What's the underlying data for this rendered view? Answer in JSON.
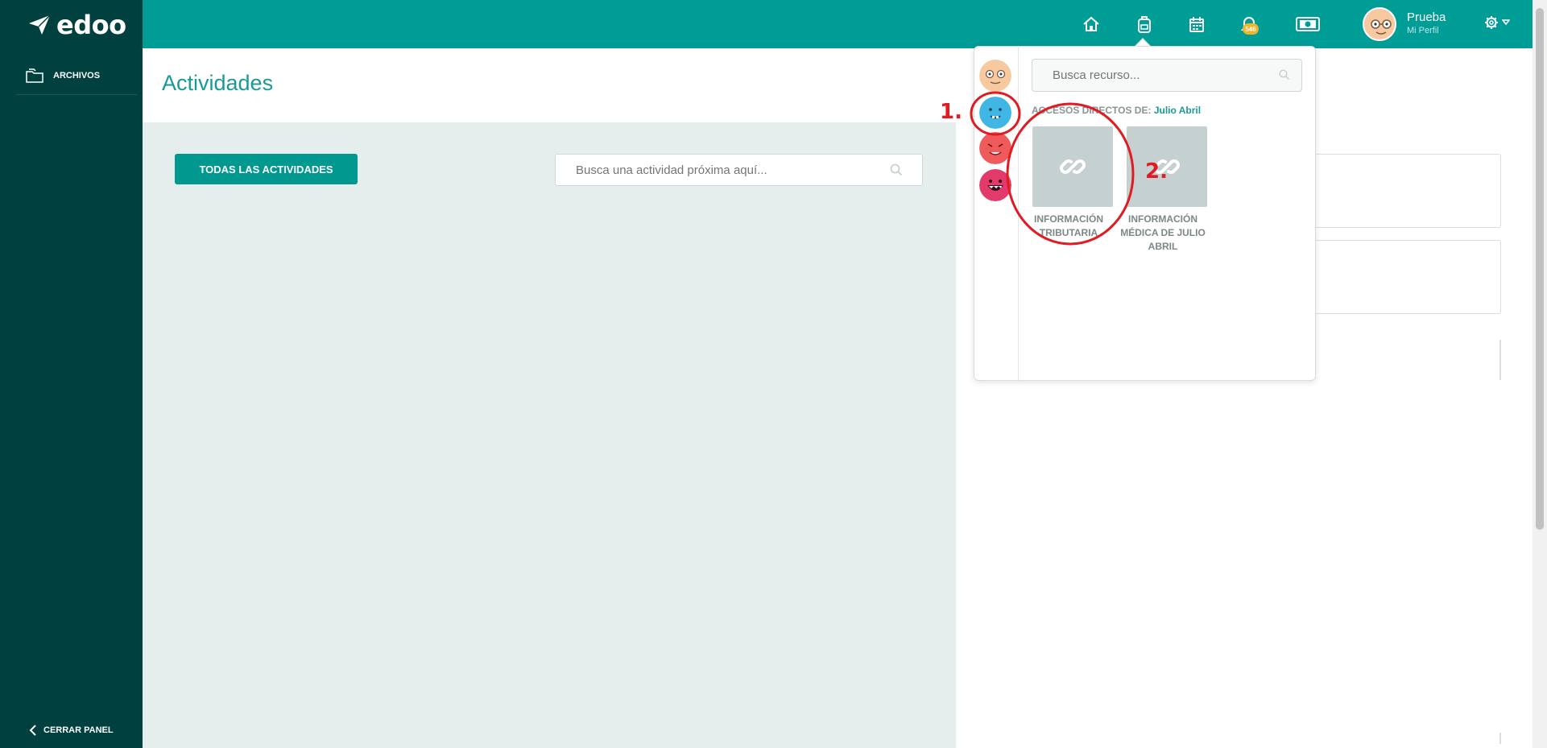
{
  "app": {
    "logo_text": "edoo"
  },
  "sidebar": {
    "items": [
      {
        "label": "ARCHIVOS",
        "icon": "folder-icon"
      }
    ],
    "close_label": "CERRAR PANEL"
  },
  "topbar": {
    "icons": [
      "home-icon",
      "backpack-icon",
      "calendar-icon",
      "bell-icon",
      "money-icon"
    ],
    "notification_count": "546",
    "user": {
      "name": "Prueba",
      "subtitle": "Mi Perfil"
    }
  },
  "main": {
    "title": "Actividades",
    "all_button": "TODAS LAS ACTIVIDADES",
    "search_placeholder": "Busca una actividad próxima aquí..."
  },
  "dropdown": {
    "search_placeholder": "Busca recurso...",
    "shortcuts_label": "ACCESOS DIRECTOS DE:",
    "shortcuts_owner": "Julio Abril",
    "tiles": [
      {
        "label": "INFORMACIÓN TRIBUTARIA",
        "icon": "link-icon"
      },
      {
        "label": "INFORMACIÓN MÉDICA DE JULIO ABRIL",
        "icon": "link-icon"
      }
    ]
  },
  "annotations": {
    "first": "1.",
    "second": "2."
  },
  "colors": {
    "sidebar": "#00413f",
    "topbar": "#009c96",
    "accent": "#1a9a94",
    "annotation": "#e01b22"
  }
}
